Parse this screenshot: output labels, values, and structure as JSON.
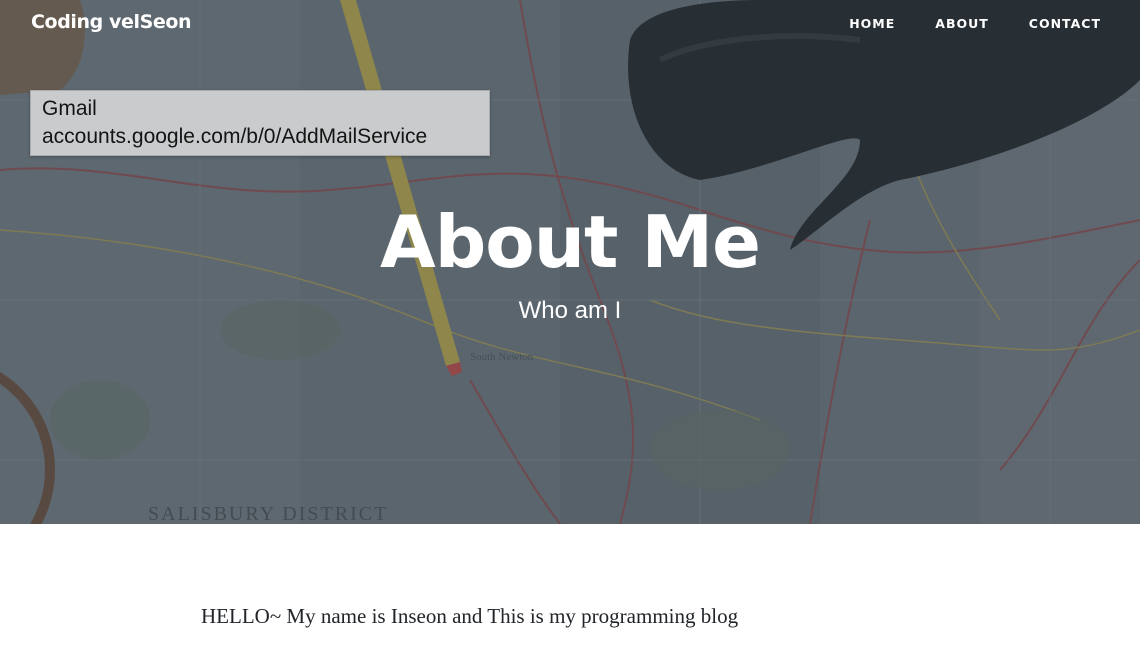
{
  "navbar": {
    "brand": "Coding velSeon",
    "links": [
      {
        "label": "HOME"
      },
      {
        "label": "ABOUT"
      },
      {
        "label": "CONTACT"
      }
    ]
  },
  "tooltip": {
    "title": "Gmail",
    "url": "accounts.google.com/b/0/AddMailService"
  },
  "hero": {
    "title": "About Me",
    "subtitle": "Who am I"
  },
  "map_labels": {
    "district": "SALISBURY DISTRICT",
    "town": "South Newton"
  },
  "content": {
    "paragraph": "HELLO~ My name is Inseon and This is my programming blog"
  },
  "colors": {
    "overlay": "#5d6670",
    "text_light": "#ffffff",
    "body_text": "#212529"
  }
}
